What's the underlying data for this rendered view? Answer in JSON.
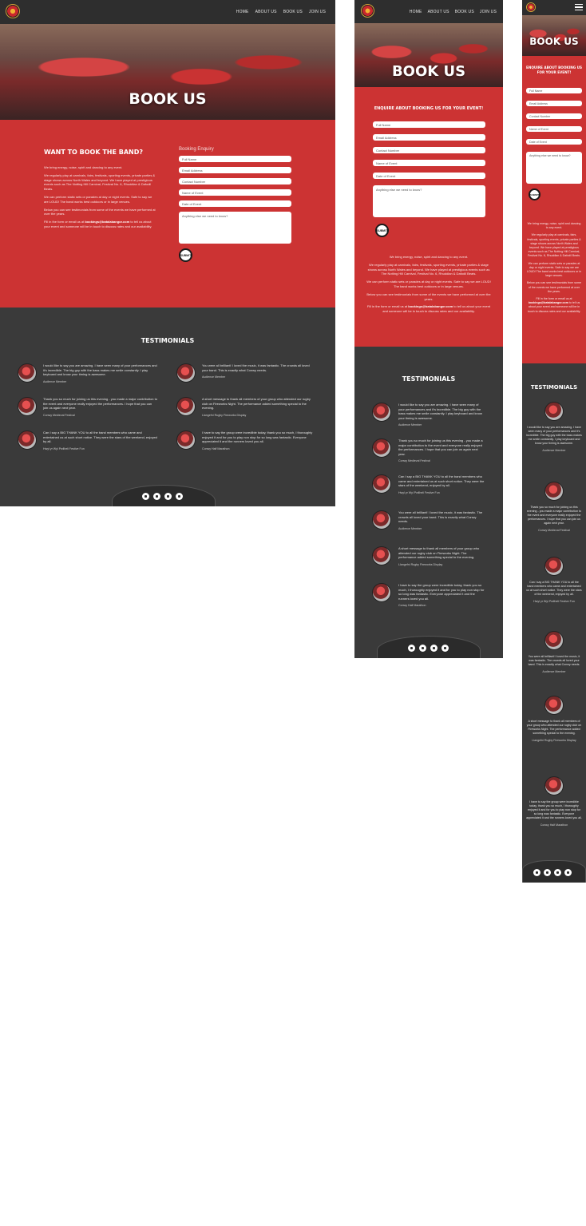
{
  "nav": {
    "items": [
      "HOME",
      "ABOUT US",
      "BOOK US",
      "JOIN US"
    ]
  },
  "hero": {
    "title": "BOOK US"
  },
  "booking": {
    "heading": "WANT TO BOOK THE BAND?",
    "heading_alt": "ENQUIRE ABOUT BOOKING US FOR YOUR EVENT!",
    "form_title": "Booking Enquiry",
    "fields": [
      "Full Name",
      "Email Address",
      "Contact Number",
      "Name of Event",
      "Date of Event"
    ],
    "textarea_placeholder": "Anything else we need to know?",
    "submit": "SUBMIT",
    "p1": "We bring energy, noise, spirit and dancing to any event.",
    "p2": "We regularly play at carnivals, fairs, festivals, sporting events, private parties & stage shows across North Wales and beyond. We have played at prestigious events such as The Notting Hill Carnival, Festival No. 6, Rhuddlan & Dafodil Beats.",
    "p3": "We can perform static sets or parades at day or night events. Safe to say we are LOUD! The band works best outdoors or in large venues.",
    "p4": "Below you can see testimonials from some of the events we have performed at over the years.",
    "p5_pre": "Fill in the form or email us at",
    "email": "bookings@batalabangor.com",
    "p5_post": "to tell us about your event and someone will be in touch to discuss rates and our availability."
  },
  "testimonials": {
    "heading": "TESTIMONIALS",
    "items": [
      {
        "quote": "I would like to say you are amazing. I have seen many of your performances and it's incredible. The big guy with the bass makes me smile constantly. I play keyboard and know your timing is awesome.",
        "name": "Audience Member"
      },
      {
        "quote": "Thank you so much for joining us this evening - you made a major contribution to the event and everyone really enjoyed the performances. I hope that you can join us again next year.",
        "name": "Conwy Medieval Festival"
      },
      {
        "quote": "Can I say a BIG THANK YOU to all the band members who came and entertained us at such short notice. They were the stars of the weekend, enjoyed by all.",
        "name": "Hwyl yr Wyl Pwllheli Festive Fun"
      },
      {
        "quote": "You were all brilliant! I loved the music, it was fantastic. The crowds all loved your band. This is exactly what Conwy needs.",
        "name": "Audience Member"
      },
      {
        "quote": "A short message to thank all members of your group who attended our rugby club on Fireworks Night. The performance added something special to the evening.",
        "name": "Llangefni Rugby Fireworks Display"
      },
      {
        "quote": "I have to say the group were incredible today, thank you so much, I thoroughly enjoyed it and for you to play non stop for so long was fantastic. Everyone appreciated it and the runners loved you all.",
        "name": "Conwy Half Marathon"
      }
    ]
  },
  "footer": {
    "icons": [
      "facebook-icon",
      "twitter-icon",
      "instagram-icon",
      "youtube-icon"
    ]
  }
}
